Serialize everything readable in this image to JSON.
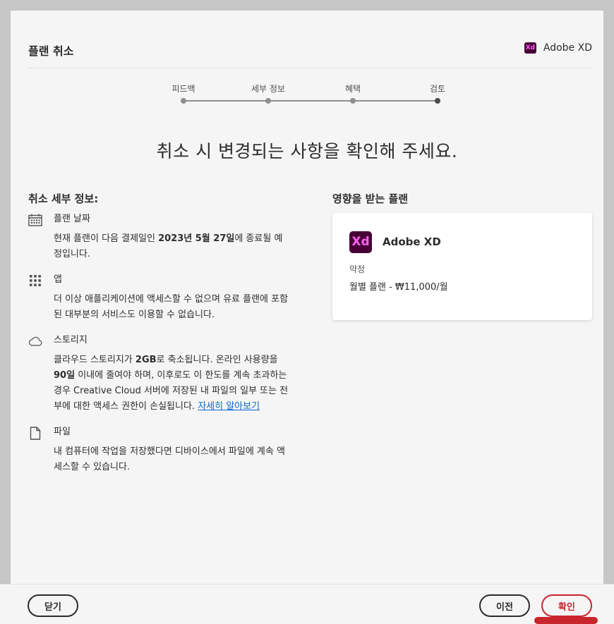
{
  "header": {
    "title": "플랜 취소",
    "brand_logo_text": "Xd",
    "brand_name": "Adobe XD"
  },
  "steps": [
    {
      "label": "피드백",
      "state": "done"
    },
    {
      "label": "세부 정보",
      "state": "done"
    },
    {
      "label": "혜택",
      "state": "done"
    },
    {
      "label": "검토",
      "state": "current"
    }
  ],
  "headline": "취소 시 변경되는 사항을 확인해 주세요.",
  "details": {
    "title": "취소 세부 정보:",
    "items": [
      {
        "icon": "calendar-icon",
        "heading": "플랜 날짜",
        "text_before": "현재 플랜이 다음 결제일인 ",
        "text_bold": "2023년 5월 27일",
        "text_after": "에 종료될 예정입니다."
      },
      {
        "icon": "apps-grid-icon",
        "heading": "앱",
        "text": "더 이상 애플리케이션에 액세스할 수 없으며 유료 플랜에 포함된 대부분의 서비스도 이용할 수 없습니다."
      },
      {
        "icon": "cloud-icon",
        "heading": "스토리지",
        "text_1": "클라우드 스토리지가 ",
        "bold_1": "2GB",
        "text_2": "로 축소됩니다. 온라인 사용량을 ",
        "bold_2": "90일",
        "text_3": " 이내에 줄여야 하며, 이후로도 이 한도를 계속 초과하는 경우 Creative Cloud 서버에 저장된 내 파일의 일부 또는 전부에 대한 액세스 권한이 손실됩니다. ",
        "link": "자세히 알아보기"
      },
      {
        "icon": "file-icon",
        "heading": "파일",
        "text": "내 컴퓨터에 작업을 저장했다면 디바이스에서 파일에 계속 액세스할 수 있습니다."
      }
    ]
  },
  "affected": {
    "title": "영향을 받는 플랜",
    "logo_text": "Xd",
    "product": "Adobe XD",
    "contract_label": "약정",
    "plan": "월별 플랜 - ₩11,000/월"
  },
  "footer": {
    "close": "닫기",
    "prev": "이전",
    "confirm": "확인"
  },
  "colors": {
    "xd_bg": "#470137",
    "xd_fg": "#ff61f6",
    "confirm": "#c9252d",
    "link": "#0d66d0"
  }
}
